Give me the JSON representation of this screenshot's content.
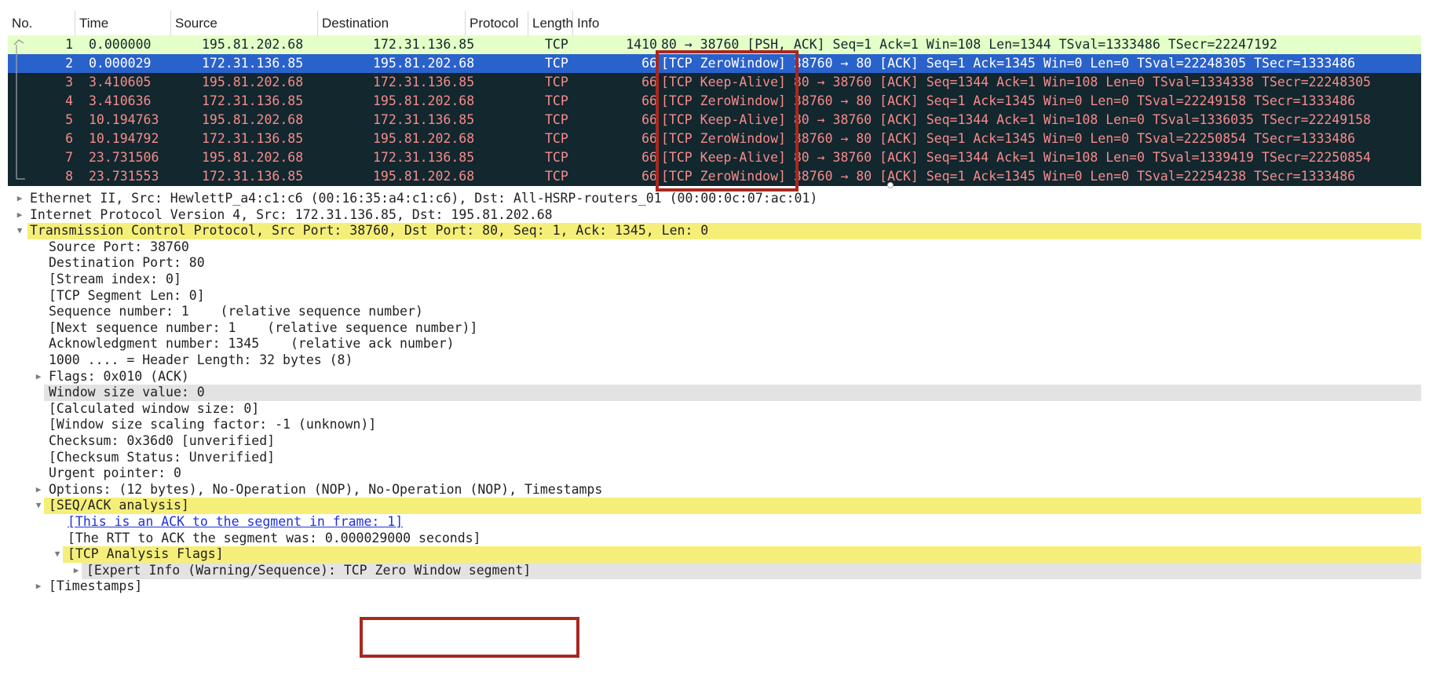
{
  "packet_list": {
    "columns": [
      "No.",
      "Time",
      "Source",
      "Destination",
      "Protocol",
      "Length",
      "Info"
    ],
    "rows": [
      {
        "no": "1",
        "time": "0.000000",
        "src": "195.81.202.68",
        "dst": "172.31.136.85",
        "proto": "TCP",
        "len": "1410",
        "info": "80 → 38760 [PSH, ACK] Seq=1 Ack=1 Win=108 Len=1344 TSval=1333486 TSecr=22247192",
        "style": "green"
      },
      {
        "no": "2",
        "time": "0.000029",
        "src": "172.31.136.85",
        "dst": "195.81.202.68",
        "proto": "TCP",
        "len": "66",
        "info": "[TCP ZeroWindow] 38760 → 80 [ACK] Seq=1 Ack=1345 Win=0 Len=0 TSval=22248305 TSecr=1333486",
        "style": "selected"
      },
      {
        "no": "3",
        "time": "3.410605",
        "src": "195.81.202.68",
        "dst": "172.31.136.85",
        "proto": "TCP",
        "len": "66",
        "info": "[TCP Keep-Alive] 80 → 38760 [ACK] Seq=1344 Ack=1 Win=108 Len=0 TSval=1334338 TSecr=22248305",
        "style": "dark"
      },
      {
        "no": "4",
        "time": "3.410636",
        "src": "172.31.136.85",
        "dst": "195.81.202.68",
        "proto": "TCP",
        "len": "66",
        "info": "[TCP ZeroWindow] 38760 → 80 [ACK] Seq=1 Ack=1345 Win=0 Len=0 TSval=22249158 TSecr=1333486",
        "style": "dark"
      },
      {
        "no": "5",
        "time": "10.194763",
        "src": "195.81.202.68",
        "dst": "172.31.136.85",
        "proto": "TCP",
        "len": "66",
        "info": "[TCP Keep-Alive] 80 → 38760 [ACK] Seq=1344 Ack=1 Win=108 Len=0 TSval=1336035 TSecr=22249158",
        "style": "dark"
      },
      {
        "no": "6",
        "time": "10.194792",
        "src": "172.31.136.85",
        "dst": "195.81.202.68",
        "proto": "TCP",
        "len": "66",
        "info": "[TCP ZeroWindow] 38760 → 80 [ACK] Seq=1 Ack=1345 Win=0 Len=0 TSval=22250854 TSecr=1333486",
        "style": "dark"
      },
      {
        "no": "7",
        "time": "23.731506",
        "src": "195.81.202.68",
        "dst": "172.31.136.85",
        "proto": "TCP",
        "len": "66",
        "info": "[TCP Keep-Alive] 80 → 38760 [ACK] Seq=1344 Ack=1 Win=108 Len=0 TSval=1339419 TSecr=22250854",
        "style": "dark"
      },
      {
        "no": "8",
        "time": "23.731553",
        "src": "172.31.136.85",
        "dst": "195.81.202.68",
        "proto": "TCP",
        "len": "66",
        "info": "[TCP ZeroWindow] 38760 → 80 [ACK] Seq=1 Ack=1345 Win=0 Len=0 TSval=22254238 TSecr=1333486",
        "style": "dark"
      }
    ]
  },
  "details": {
    "rows": [
      {
        "text": "Ethernet II, Src: HewlettP_a4:c1:c6 (00:16:35:a4:c1:c6), Dst: All-HSRP-routers_01 (00:00:0c:07:ac:01)",
        "level": 0,
        "tri": "right",
        "bg": ""
      },
      {
        "text": "Internet Protocol Version 4, Src: 172.31.136.85, Dst: 195.81.202.68",
        "level": 0,
        "tri": "right",
        "bg": ""
      },
      {
        "text": "Transmission Control Protocol, Src Port: 38760, Dst Port: 80, Seq: 1, Ack: 1345, Len: 0",
        "level": 0,
        "tri": "down",
        "bg": "yellow"
      },
      {
        "text": "Source Port: 38760",
        "level": 1,
        "tri": "",
        "bg": ""
      },
      {
        "text": "Destination Port: 80",
        "level": 1,
        "tri": "",
        "bg": ""
      },
      {
        "text": "[Stream index: 0]",
        "level": 1,
        "tri": "",
        "bg": ""
      },
      {
        "text": "[TCP Segment Len: 0]",
        "level": 1,
        "tri": "",
        "bg": ""
      },
      {
        "text": "Sequence number: 1    (relative sequence number)",
        "level": 1,
        "tri": "",
        "bg": ""
      },
      {
        "text": "[Next sequence number: 1    (relative sequence number)]",
        "level": 1,
        "tri": "",
        "bg": ""
      },
      {
        "text": "Acknowledgment number: 1345    (relative ack number)",
        "level": 1,
        "tri": "",
        "bg": ""
      },
      {
        "text": "1000 .... = Header Length: 32 bytes (8)",
        "level": 1,
        "tri": "",
        "bg": ""
      },
      {
        "text": "Flags: 0x010 (ACK)",
        "level": 1,
        "tri": "right",
        "bg": ""
      },
      {
        "text": "Window size value: 0",
        "level": 1,
        "tri": "",
        "bg": "gray"
      },
      {
        "text": "[Calculated window size: 0]",
        "level": 1,
        "tri": "",
        "bg": ""
      },
      {
        "text": "[Window size scaling factor: -1 (unknown)]",
        "level": 1,
        "tri": "",
        "bg": ""
      },
      {
        "text": "Checksum: 0x36d0 [unverified]",
        "level": 1,
        "tri": "",
        "bg": ""
      },
      {
        "text": "[Checksum Status: Unverified]",
        "level": 1,
        "tri": "",
        "bg": ""
      },
      {
        "text": "Urgent pointer: 0",
        "level": 1,
        "tri": "",
        "bg": ""
      },
      {
        "text": "Options: (12 bytes), No-Operation (NOP), No-Operation (NOP), Timestamps",
        "level": 1,
        "tri": "right",
        "bg": ""
      },
      {
        "text": "[SEQ/ACK analysis]",
        "level": 1,
        "tri": "down",
        "bg": "yellow"
      },
      {
        "text": "[This is an ACK to the segment in frame: 1]",
        "level": 2,
        "tri": "",
        "bg": "",
        "link": true
      },
      {
        "text": "[The RTT to ACK the segment was: 0.000029000 seconds]",
        "level": 2,
        "tri": "",
        "bg": ""
      },
      {
        "text": "[TCP Analysis Flags]",
        "level": 2,
        "tri": "down",
        "bg": "yellow"
      },
      {
        "text": "[Expert Info (Warning/Sequence): TCP Zero Window segment]",
        "level": 3,
        "tri": "right",
        "bg": "gray"
      },
      {
        "text": "[Timestamps]",
        "level": 1,
        "tri": "right",
        "bg": ""
      }
    ]
  },
  "colors": {
    "green_row": "#e4ffc7",
    "selected_row": "#2a62cc",
    "dark_row": "#12272e",
    "dark_row_text": "#f78b8b",
    "yellow_highlight": "#f5ef79",
    "gray_highlight": "#e3e3e3",
    "annotation_box": "#a9271f"
  }
}
